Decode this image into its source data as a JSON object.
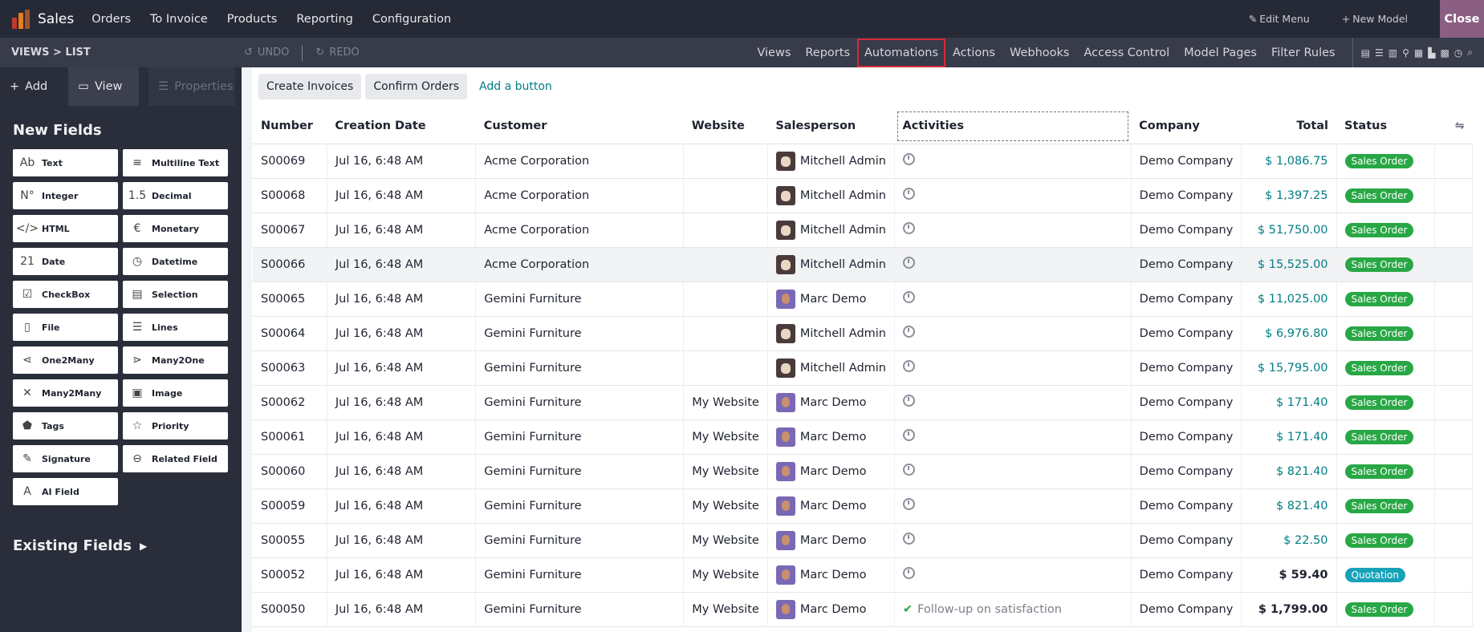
{
  "topbar": {
    "app_title": "Sales",
    "menu": [
      "Orders",
      "To Invoice",
      "Products",
      "Reporting",
      "Configuration"
    ],
    "edit_menu": "Edit Menu",
    "new_model": "New Model",
    "close": "Close"
  },
  "subbar": {
    "breadcrumb": "VIEWS > LIST",
    "undo": "UNDO",
    "redo": "REDO",
    "tabs": [
      "Views",
      "Reports",
      "Automations",
      "Actions",
      "Webhooks",
      "Access Control",
      "Model Pages",
      "Filter Rules"
    ],
    "active_tab": "Automations"
  },
  "sidebar": {
    "tabs": {
      "add": "Add",
      "view": "View",
      "properties": "Properties"
    },
    "new_fields_heading": "New Fields",
    "fields": [
      {
        "label": "Text",
        "icon": "Ab"
      },
      {
        "label": "Multiline Text",
        "icon": "≡"
      },
      {
        "label": "Integer",
        "icon": "N°"
      },
      {
        "label": "Decimal",
        "icon": "1.5"
      },
      {
        "label": "HTML",
        "icon": "</>"
      },
      {
        "label": "Monetary",
        "icon": "€"
      },
      {
        "label": "Date",
        "icon": "21"
      },
      {
        "label": "Datetime",
        "icon": "◷"
      },
      {
        "label": "CheckBox",
        "icon": "☑"
      },
      {
        "label": "Selection",
        "icon": "▤"
      },
      {
        "label": "File",
        "icon": "▯"
      },
      {
        "label": "Lines",
        "icon": "☰"
      },
      {
        "label": "One2Many",
        "icon": "⋖"
      },
      {
        "label": "Many2One",
        "icon": "⋗"
      },
      {
        "label": "Many2Many",
        "icon": "✕"
      },
      {
        "label": "Image",
        "icon": "▣"
      },
      {
        "label": "Tags",
        "icon": "⬟"
      },
      {
        "label": "Priority",
        "icon": "☆"
      },
      {
        "label": "Signature",
        "icon": "✎"
      },
      {
        "label": "Related Field",
        "icon": "⊖"
      },
      {
        "label": "AI Field",
        "icon": "A"
      }
    ],
    "existing_fields_heading": "Existing Fields"
  },
  "main": {
    "buttons": [
      "Create Invoices",
      "Confirm Orders"
    ],
    "add_button_link": "Add a button",
    "columns": [
      "Number",
      "Creation Date",
      "Customer",
      "Website",
      "Salesperson",
      "Activities",
      "Company",
      "Total",
      "Status"
    ],
    "rows": [
      {
        "number": "S00069",
        "date": "Jul 16, 6:48 AM",
        "customer": "Acme Corporation",
        "website": "",
        "salesperson": "Mitchell Admin",
        "avatar": "mitchell",
        "activity": "",
        "company": "Demo Company",
        "total": "$ 1,086.75",
        "status": "Sales Order"
      },
      {
        "number": "S00068",
        "date": "Jul 16, 6:48 AM",
        "customer": "Acme Corporation",
        "website": "",
        "salesperson": "Mitchell Admin",
        "avatar": "mitchell",
        "activity": "",
        "company": "Demo Company",
        "total": "$ 1,397.25",
        "status": "Sales Order"
      },
      {
        "number": "S00067",
        "date": "Jul 16, 6:48 AM",
        "customer": "Acme Corporation",
        "website": "",
        "salesperson": "Mitchell Admin",
        "avatar": "mitchell",
        "activity": "",
        "company": "Demo Company",
        "total": "$ 51,750.00",
        "status": "Sales Order"
      },
      {
        "number": "S00066",
        "date": "Jul 16, 6:48 AM",
        "customer": "Acme Corporation",
        "website": "",
        "salesperson": "Mitchell Admin",
        "avatar": "mitchell",
        "activity": "",
        "company": "Demo Company",
        "total": "$ 15,525.00",
        "status": "Sales Order"
      },
      {
        "number": "S00065",
        "date": "Jul 16, 6:48 AM",
        "customer": "Gemini Furniture",
        "website": "",
        "salesperson": "Marc Demo",
        "avatar": "marc",
        "activity": "",
        "company": "Demo Company",
        "total": "$ 11,025.00",
        "status": "Sales Order"
      },
      {
        "number": "S00064",
        "date": "Jul 16, 6:48 AM",
        "customer": "Gemini Furniture",
        "website": "",
        "salesperson": "Mitchell Admin",
        "avatar": "mitchell",
        "activity": "",
        "company": "Demo Company",
        "total": "$ 6,976.80",
        "status": "Sales Order"
      },
      {
        "number": "S00063",
        "date": "Jul 16, 6:48 AM",
        "customer": "Gemini Furniture",
        "website": "",
        "salesperson": "Mitchell Admin",
        "avatar": "mitchell",
        "activity": "",
        "company": "Demo Company",
        "total": "$ 15,795.00",
        "status": "Sales Order"
      },
      {
        "number": "S00062",
        "date": "Jul 16, 6:48 AM",
        "customer": "Gemini Furniture",
        "website": "My Website",
        "salesperson": "Marc Demo",
        "avatar": "marc",
        "activity": "",
        "company": "Demo Company",
        "total": "$ 171.40",
        "status": "Sales Order"
      },
      {
        "number": "S00061",
        "date": "Jul 16, 6:48 AM",
        "customer": "Gemini Furniture",
        "website": "My Website",
        "salesperson": "Marc Demo",
        "avatar": "marc",
        "activity": "",
        "company": "Demo Company",
        "total": "$ 171.40",
        "status": "Sales Order"
      },
      {
        "number": "S00060",
        "date": "Jul 16, 6:48 AM",
        "customer": "Gemini Furniture",
        "website": "My Website",
        "salesperson": "Marc Demo",
        "avatar": "marc",
        "activity": "",
        "company": "Demo Company",
        "total": "$ 821.40",
        "status": "Sales Order"
      },
      {
        "number": "S00059",
        "date": "Jul 16, 6:48 AM",
        "customer": "Gemini Furniture",
        "website": "My Website",
        "salesperson": "Marc Demo",
        "avatar": "marc",
        "activity": "",
        "company": "Demo Company",
        "total": "$ 821.40",
        "status": "Sales Order"
      },
      {
        "number": "S00055",
        "date": "Jul 16, 6:48 AM",
        "customer": "Gemini Furniture",
        "website": "My Website",
        "salesperson": "Marc Demo",
        "avatar": "marc",
        "activity": "",
        "company": "Demo Company",
        "total": "$ 22.50",
        "status": "Sales Order"
      },
      {
        "number": "S00052",
        "date": "Jul 16, 6:48 AM",
        "customer": "Gemini Furniture",
        "website": "My Website",
        "salesperson": "Marc Demo",
        "avatar": "marc",
        "activity": "",
        "company": "Demo Company",
        "total": "$ 59.40",
        "status": "Quotation"
      },
      {
        "number": "S00050",
        "date": "Jul 16, 6:48 AM",
        "customer": "Gemini Furniture",
        "website": "My Website",
        "salesperson": "Marc Demo",
        "avatar": "marc",
        "activity": "Follow-up on satisfaction",
        "company": "Demo Company",
        "total": "$ 1,799.00",
        "status": "Sales Order"
      }
    ],
    "highlighted_row": 3
  },
  "colors": {
    "sales_order": "#28a745",
    "quotation": "#17a2b8",
    "link": "#017e84",
    "active_tab_outline": "#d62b36"
  }
}
